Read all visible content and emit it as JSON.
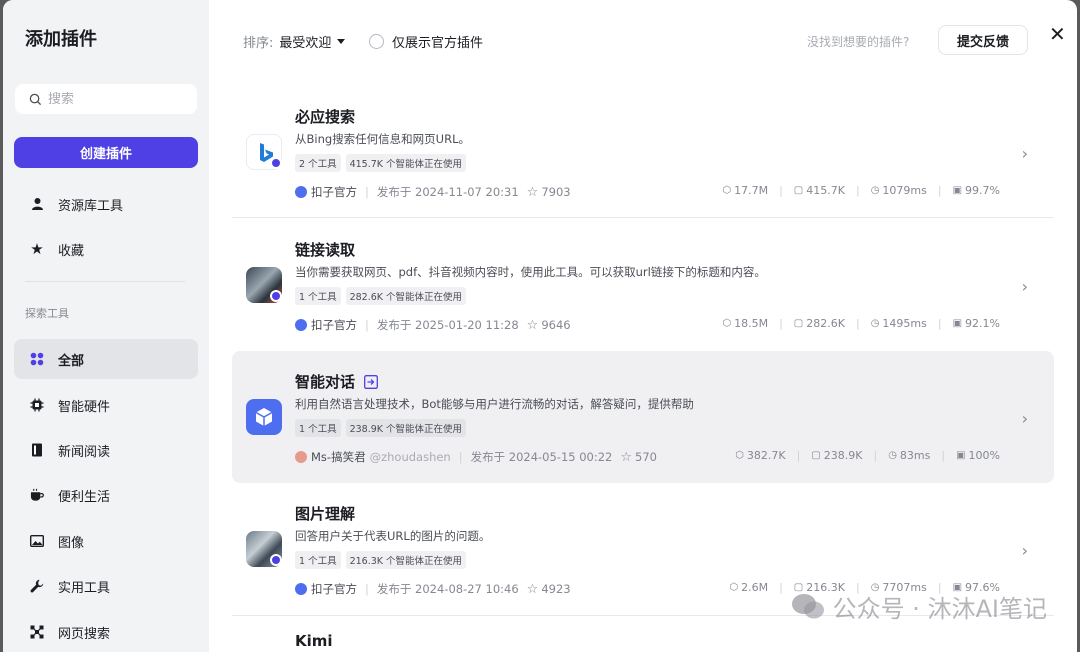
{
  "sidebar": {
    "title": "添加插件",
    "search_placeholder": "搜索",
    "create_label": "创建插件",
    "items": [
      {
        "label": "资源库工具",
        "icon": "person-icon"
      },
      {
        "label": "收藏",
        "icon": "star-icon"
      }
    ],
    "section_label": "探索工具",
    "categories": [
      {
        "label": "全部",
        "icon": "grid-icon",
        "active": true
      },
      {
        "label": "智能硬件",
        "icon": "chip-icon"
      },
      {
        "label": "新闻阅读",
        "icon": "book-icon"
      },
      {
        "label": "便利生活",
        "icon": "cup-icon"
      },
      {
        "label": "图像",
        "icon": "image-icon"
      },
      {
        "label": "实用工具",
        "icon": "wrench-icon"
      },
      {
        "label": "网页搜索",
        "icon": "network-icon"
      }
    ]
  },
  "topbar": {
    "sort_label": "排序:",
    "sort_value": "最受欢迎",
    "official_only": "仅展示官方插件",
    "not_found": "没找到想要的插件?",
    "feedback": "提交反馈",
    "close": "✕"
  },
  "plugins": [
    {
      "name": "必应搜索",
      "desc": "从Bing搜索任何信息和网页URL。",
      "tools": "2 个工具",
      "usage": "415.7K 个智能体正在使用",
      "author": "扣子官方",
      "published": "发布于 2024-11-07 20:31",
      "stars": "7903",
      "calls": "17.7M",
      "bots": "415.7K",
      "latency": "1079ms",
      "success": "99.7%",
      "avatar": "bing"
    },
    {
      "name": "链接读取",
      "desc": "当你需要获取网页、pdf、抖音视频内容时，使用此工具。可以获取url链接下的标题和内容。",
      "tools": "1 个工具",
      "usage": "282.6K 个智能体正在使用",
      "author": "扣子官方",
      "published": "发布于 2025-01-20 11:28",
      "stars": "9646",
      "calls": "18.5M",
      "bots": "282.6K",
      "latency": "1495ms",
      "success": "92.1%",
      "avatar": "robot"
    },
    {
      "name": "智能对话",
      "desc": "利用自然语言处理技术，Bot能够与用户进行流畅的对话，解答疑问，提供帮助",
      "tools": "1 个工具",
      "usage": "238.9K 个智能体正在使用",
      "author": "Ms-搞笑君",
      "handle": "@zhoudashen",
      "published": "发布于 2024-05-15 00:22",
      "stars": "570",
      "calls": "382.7K",
      "bots": "238.9K",
      "latency": "83ms",
      "success": "100%",
      "avatar": "cube"
    },
    {
      "name": "图片理解",
      "desc": "回答用户关于代表URL的图片的问题。",
      "tools": "1 个工具",
      "usage": "216.3K 个智能体正在使用",
      "author": "扣子官方",
      "published": "发布于 2024-08-27 10:46",
      "stars": "4923",
      "calls": "2.6M",
      "bots": "216.3K",
      "latency": "7707ms",
      "success": "97.6%",
      "avatar": "robot2"
    },
    {
      "name": "Kimi"
    }
  ],
  "watermark": "公众号 · 沐沐AI笔记",
  "colors": {
    "accent": "#4e40e5",
    "sidebar_bg": "#f2f3f5",
    "highlight_bg": "#f0f0f3"
  }
}
